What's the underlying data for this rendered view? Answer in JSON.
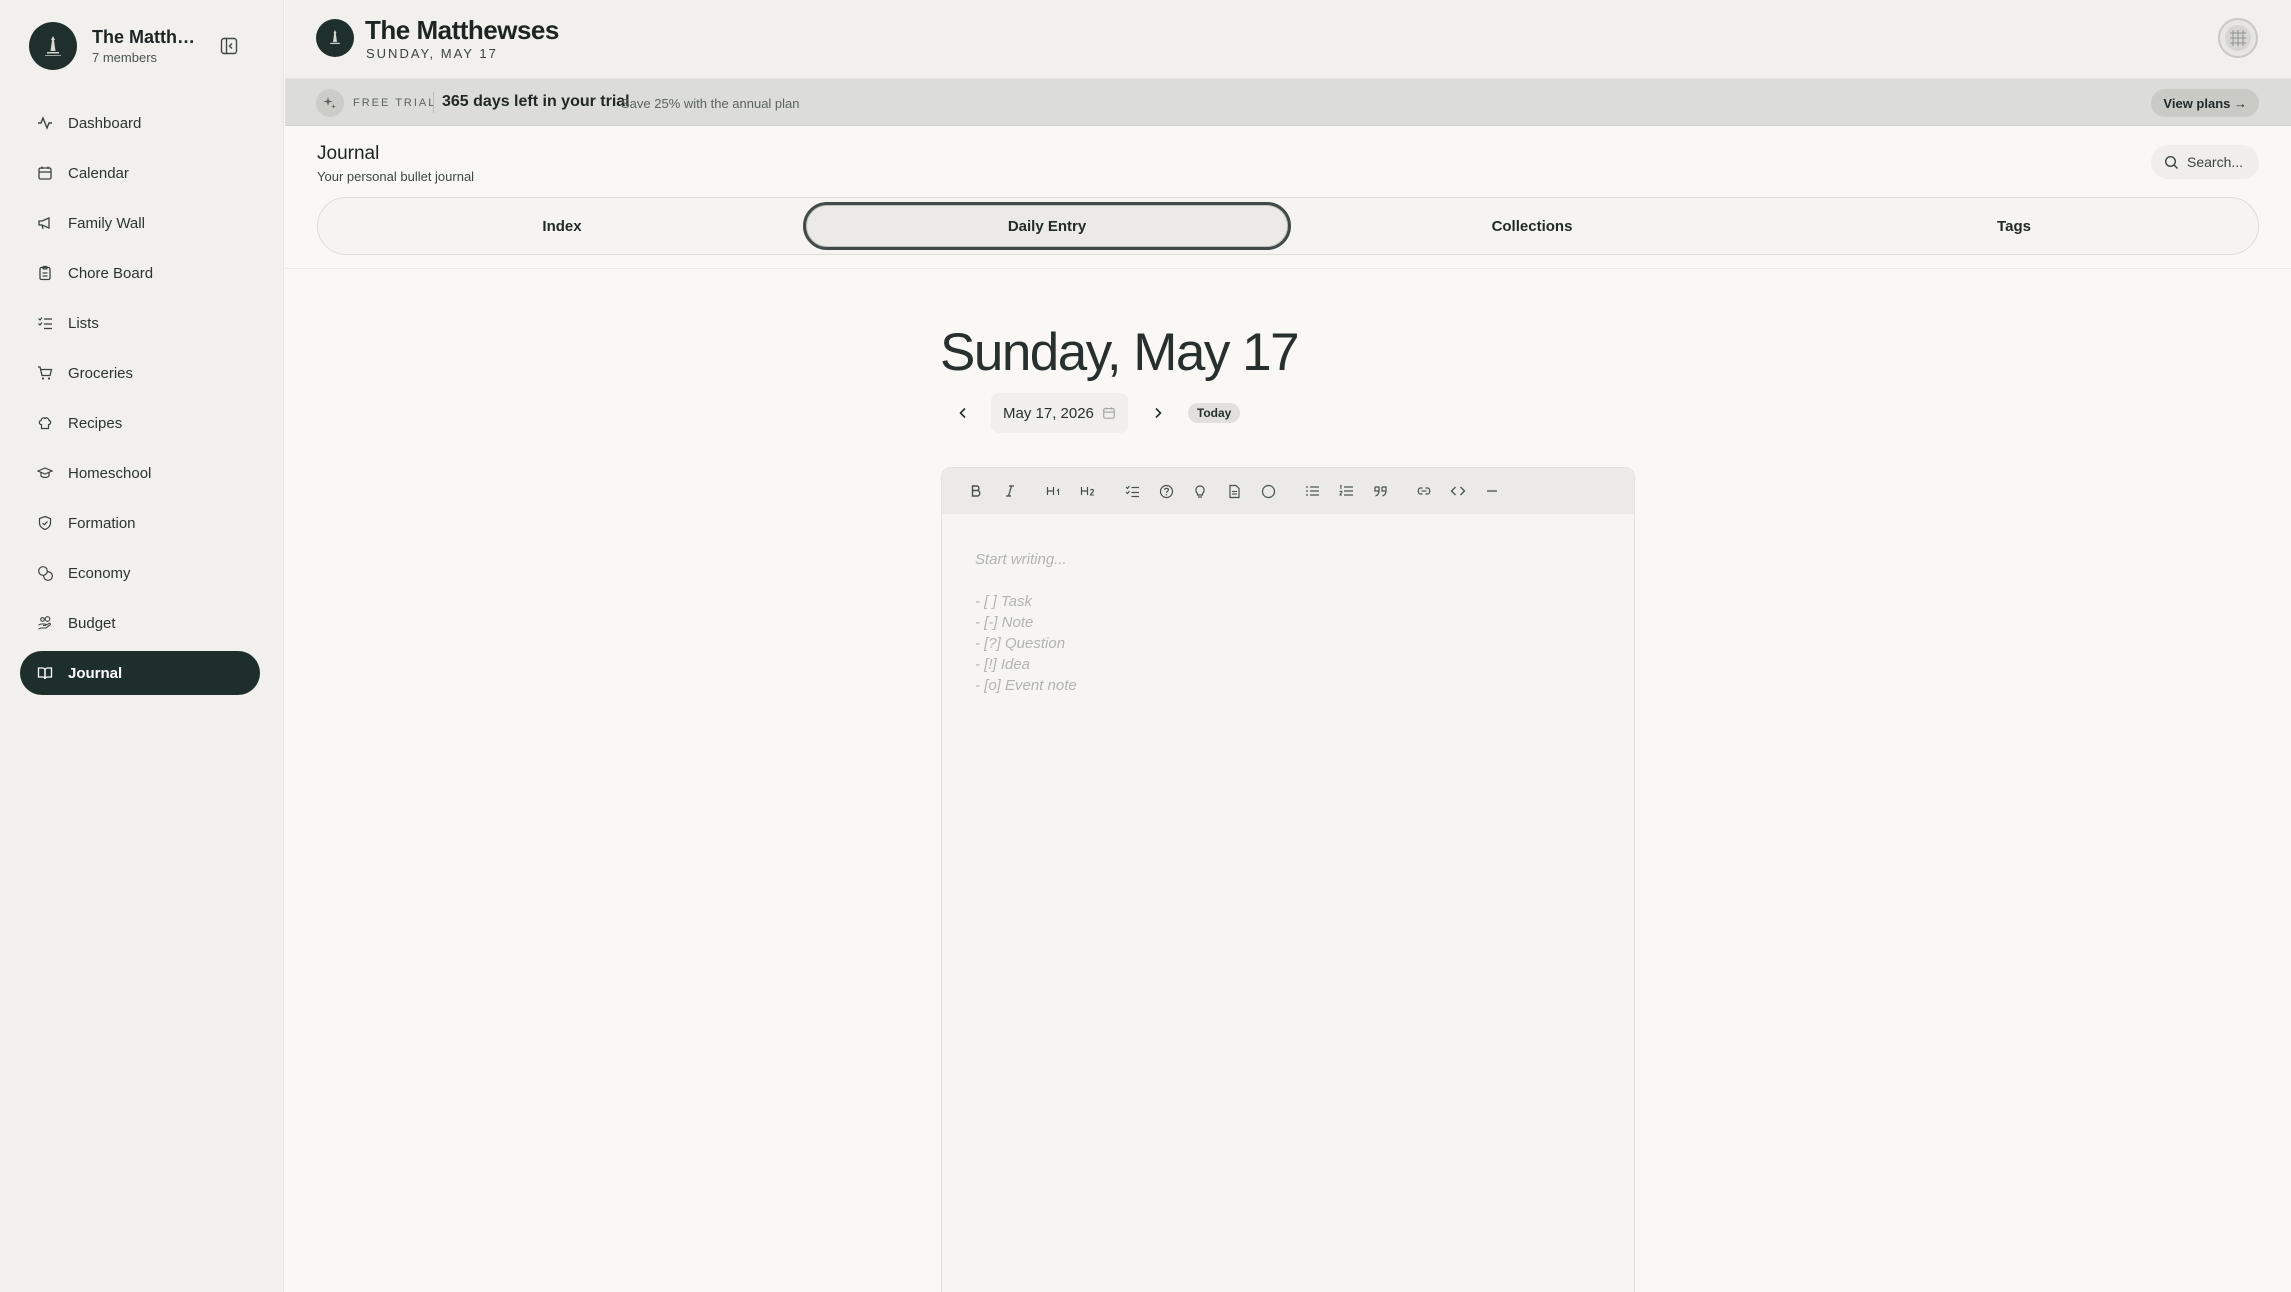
{
  "app": {
    "family_name": "The Matthewses",
    "family_name_sidebar": "The Matthe...",
    "members": "7 members",
    "date_caps": "SUNDAY, MAY 17"
  },
  "sidebar": {
    "items": [
      {
        "label": "Dashboard",
        "icon": "activity-icon"
      },
      {
        "label": "Calendar",
        "icon": "calendar-icon"
      },
      {
        "label": "Family Wall",
        "icon": "megaphone-icon"
      },
      {
        "label": "Chore Board",
        "icon": "clipboard-icon"
      },
      {
        "label": "Lists",
        "icon": "list-checks-icon"
      },
      {
        "label": "Groceries",
        "icon": "cart-icon"
      },
      {
        "label": "Recipes",
        "icon": "chef-hat-icon"
      },
      {
        "label": "Homeschool",
        "icon": "graduation-cap-icon"
      },
      {
        "label": "Formation",
        "icon": "shield-icon"
      },
      {
        "label": "Economy",
        "icon": "coins-icon"
      },
      {
        "label": "Budget",
        "icon": "hand-coins-icon"
      },
      {
        "label": "Journal",
        "icon": "book-open-icon",
        "active": true
      }
    ]
  },
  "trial": {
    "tag": "FREE TRIAL",
    "days": "365 days left in your trial",
    "save": "Save 25% with the annual plan",
    "cta": "View plans →"
  },
  "journal": {
    "title": "Journal",
    "subtitle": "Your personal bullet journal",
    "search_placeholder": "Search...",
    "tabs": [
      "Index",
      "Daily Entry",
      "Collections",
      "Tags"
    ],
    "active_tab": "Daily Entry"
  },
  "entry": {
    "heading": "Sunday, May 17",
    "date_value": "May 17, 2026",
    "today_label": "Today",
    "placeholder_lines": [
      "Start writing...",
      "",
      "- [ ] Task",
      "- [-] Note",
      "- [?] Question",
      "- [!] Idea",
      "- [o] Event note"
    ]
  },
  "colors": {
    "accent": "#1e2e2b",
    "sidebar_bg": "#f1f0ec",
    "page_bg": "#f9f8f4",
    "banner_bg": "#dcdcd8"
  }
}
